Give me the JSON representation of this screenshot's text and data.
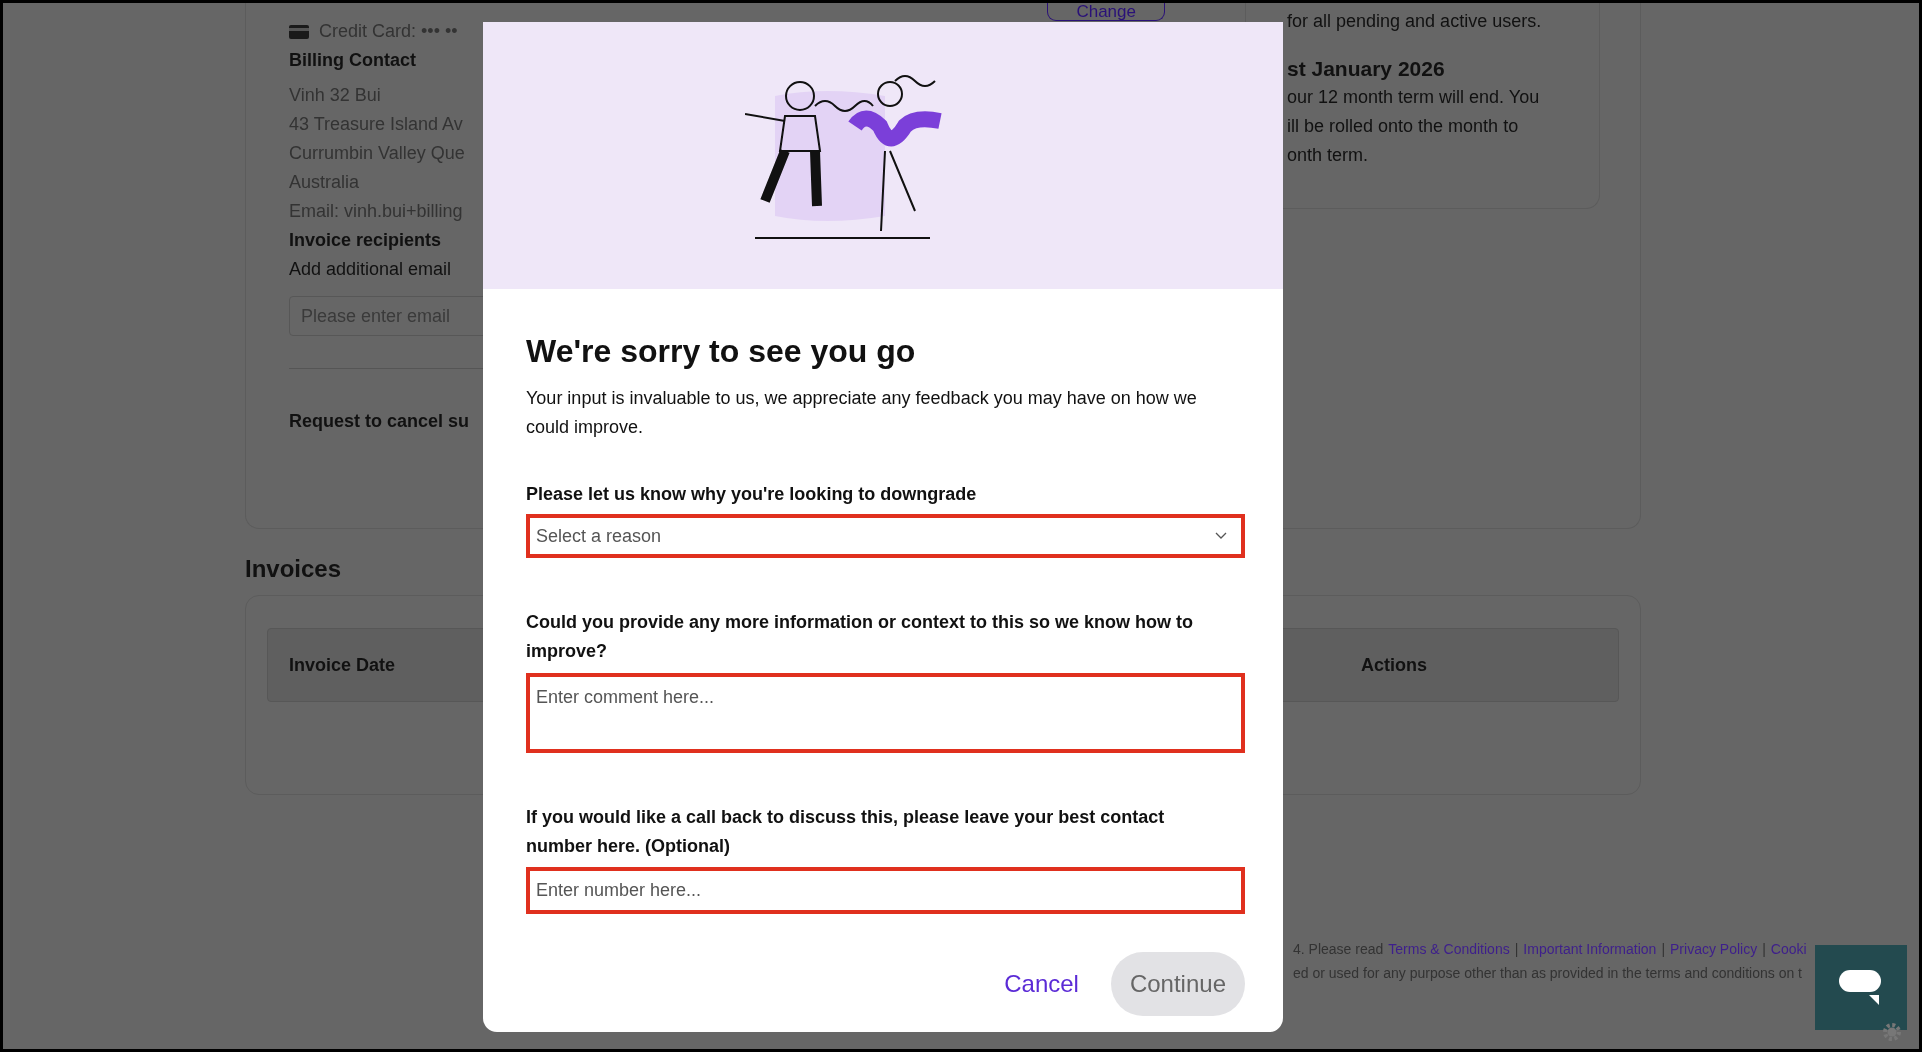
{
  "background_page": {
    "billing": {
      "payment_method": "Credit Card: ••• ••",
      "heading": "Billing Contact",
      "address_lines": [
        "Vinh 32 Bui",
        "43 Treasure Island Av",
        "Currumbin Valley Que",
        "Australia"
      ],
      "email": "Email: vinh.bui+billing",
      "recipients_heading": "Invoice recipients",
      "recipients_hint": "Add additional email",
      "email_field": {
        "placeholder": "Please enter email"
      },
      "cancel_request": "Request to cancel su"
    },
    "change_button": "Change",
    "term_info": {
      "top_line": "for all pending and active users.",
      "heading": "st January 2026",
      "lines": [
        "our 12 month term will end. You",
        "ill be rolled onto the month to",
        "onth term."
      ]
    },
    "invoices": {
      "title": "Invoices",
      "columns": [
        "Invoice Date",
        "Actions"
      ]
    },
    "footer": {
      "lead": "4. Please read",
      "separator": "|",
      "links": [
        "Terms & Conditions",
        "Important Information",
        "Privacy Policy",
        "Cooki"
      ],
      "notice": "ed or used for any purpose other than as provided in the terms and conditions on t"
    }
  },
  "modal": {
    "title": "We're sorry to see you go",
    "intro": "Your input is invaluable to us, we appreciate any feedback you may have on how we could improve.",
    "fields": [
      {
        "kind": "select",
        "label": "Please let us know why you're looking to downgrade",
        "placeholder": "Select a reason",
        "highlighted": true
      },
      {
        "kind": "textarea",
        "label": "Could you provide any more information or context to this so we know how to improve?",
        "placeholder": "Enter comment here...",
        "highlighted": true
      },
      {
        "kind": "input",
        "label": "If you would like a call back to discuss this, please leave your best contact number here. (Optional)",
        "placeholder": "Enter number here...",
        "highlighted": true
      }
    ],
    "cancel": "Cancel",
    "continue": {
      "label": "Continue",
      "disabled": true
    }
  }
}
